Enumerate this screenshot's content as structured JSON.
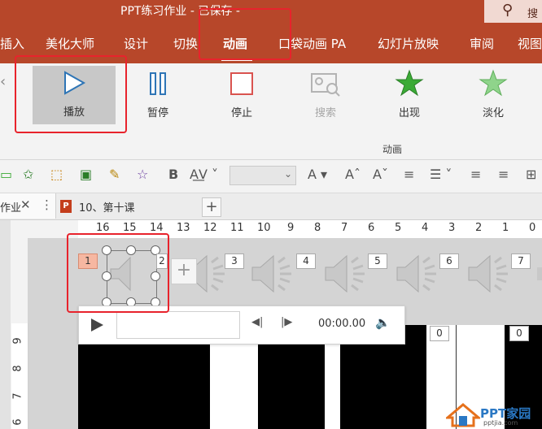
{
  "title": {
    "text": "PPT练习作业 - 已保存 -",
    "search_label": "搜"
  },
  "tabs": [
    "插入",
    "美化大师",
    "设计",
    "切换",
    "动画",
    "口袋动画 PA",
    "幻灯片放映",
    "审阅",
    "视图"
  ],
  "active_tab": "动画",
  "ribbon": {
    "play": "播放",
    "pause": "暂停",
    "stop": "停止",
    "search": "搜索",
    "appear": "出现",
    "fade": "淡化",
    "group_label": "动画"
  },
  "font_size_placeholder": "",
  "doc_tabs": {
    "tab1": "作业",
    "tab2": "10、第十课"
  },
  "ruler_h": [
    "16",
    "15",
    "14",
    "13",
    "12",
    "11",
    "10",
    "9",
    "8",
    "7",
    "6",
    "5",
    "4",
    "3",
    "2",
    "1",
    "0"
  ],
  "ruler_v": [
    "9",
    "8",
    "7",
    "6"
  ],
  "audio_badges": [
    "1",
    "2",
    "3",
    "4",
    "5",
    "6",
    "7"
  ],
  "media": {
    "time": "00:00.00"
  },
  "slide_badges": [
    "0",
    "0"
  ],
  "watermark": {
    "text": "PPT家园",
    "url": "pptjia.com"
  },
  "colors": {
    "accent": "#b7472a",
    "highlight": "#e8232c",
    "star": "#3aaa35"
  }
}
